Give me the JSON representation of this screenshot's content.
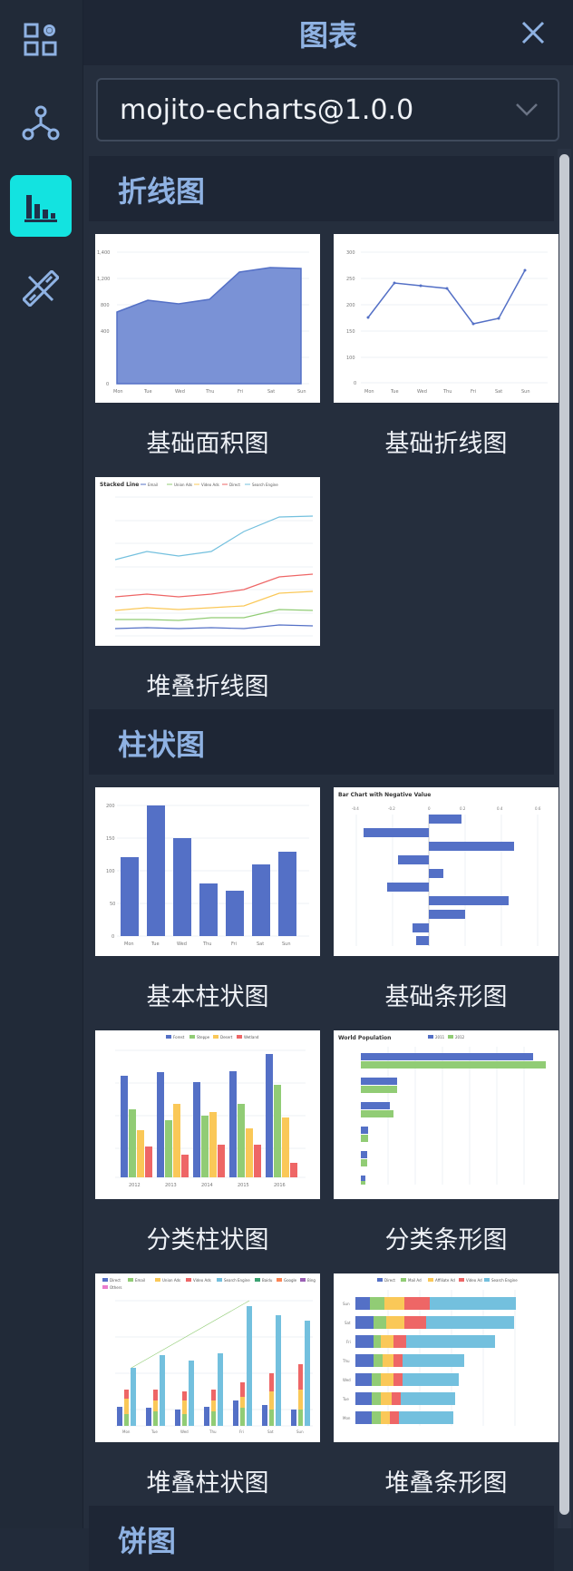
{
  "panel": {
    "title": "图表",
    "close_label": "X",
    "library_select": {
      "value": "mojito-echarts@1.0.0"
    }
  },
  "rail": {
    "items": [
      {
        "icon": "components-gear-icon",
        "active": false
      },
      {
        "icon": "graph-nodes-icon",
        "active": false
      },
      {
        "icon": "bar-chart-icon",
        "active": true
      },
      {
        "icon": "tools-icon",
        "active": false
      }
    ]
  },
  "sections": [
    {
      "title": "折线图",
      "items": [
        {
          "caption": "基础面积图"
        },
        {
          "caption": "基础折线图"
        },
        {
          "caption": "堆叠折线图",
          "preview_title": "Stacked Line",
          "legend": [
            "Email",
            "Union Ads",
            "Video Ads",
            "Direct",
            "Search Engine"
          ]
        }
      ]
    },
    {
      "title": "柱状图",
      "items": [
        {
          "caption": "基本柱状图"
        },
        {
          "caption": "基础条形图",
          "preview_title": "Bar Chart with Negative Value"
        },
        {
          "caption": "分类柱状图",
          "legend": [
            "Forest",
            "Steppe",
            "Desert",
            "Wetland"
          ]
        },
        {
          "caption": "分类条形图",
          "preview_title": "World Population",
          "legend": [
            "2011",
            "2012"
          ]
        },
        {
          "caption": "堆叠柱状图"
        },
        {
          "caption": "堆叠条形图",
          "legend": [
            "Direct",
            "Mail Ad",
            "Affiliate Ad",
            "Video Ad",
            "Search Engine"
          ]
        }
      ]
    },
    {
      "title": "饼图"
    }
  ],
  "colors": {
    "accent": "#13e3e0",
    "title": "#8fb2e3",
    "echarts_blue": "#5470c6",
    "echarts_green": "#91cc75",
    "echarts_yellow": "#fac858",
    "echarts_red": "#ee6666",
    "echarts_cyan": "#73c0de"
  }
}
